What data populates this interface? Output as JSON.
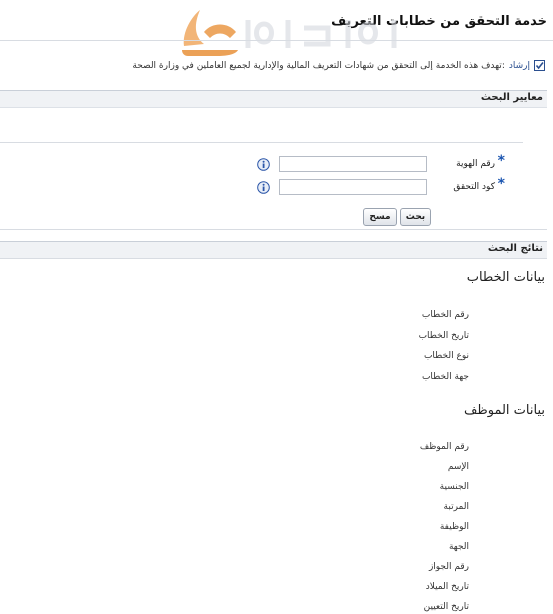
{
  "page": {
    "title": "خدمة التحقق من خطابات التعريف"
  },
  "notice": {
    "lead": "إرشاد",
    "text": ":تهدف هذه الخدمة إلى التحقق من شهادات التعريف المالية والإدارية لجميع العاملين في وزارة الصحة"
  },
  "search": {
    "header": "معايير البحث",
    "id_label": "رقم الهوية",
    "code_label": "كود التحقق",
    "id_value": "",
    "code_value": "",
    "search_button": "بحث",
    "clear_button": "مسح"
  },
  "results": {
    "header": "نتائج البحث",
    "letter_title": "بيانات الخطاب",
    "letter_fields": [
      "رقم الخطاب",
      "تاريخ الخطاب",
      "نوع الخطاب",
      "جهة الخطاب"
    ],
    "employee_title": "بيانات الموظف",
    "employee_fields": [
      "رقم الموظف",
      "الإسم",
      "الجنسية",
      "المرتبة",
      "الوظيفة",
      "الجهة",
      "رقم الجواز",
      "تاريخ الميلاد",
      "تاريخ التعيين"
    ]
  },
  "colors": {
    "accent": "#1b55b0",
    "header_bg": "#f0f2f5",
    "watermark": "#e8913a"
  }
}
